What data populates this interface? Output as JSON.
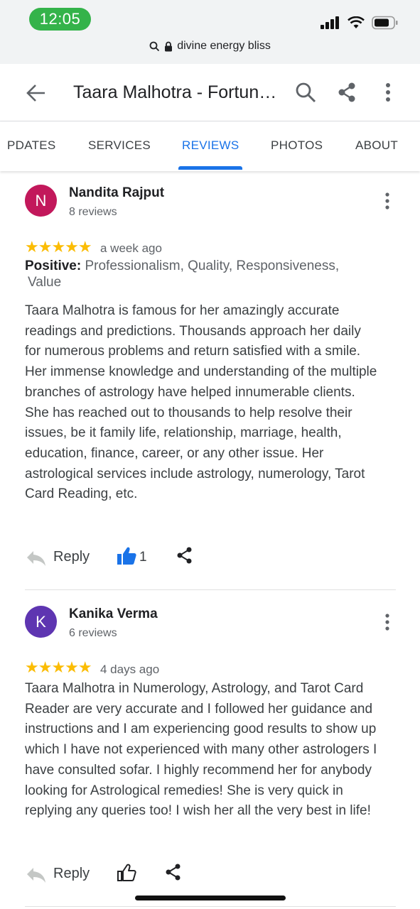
{
  "status": {
    "time": "12:05"
  },
  "url": {
    "text": "divine energy bliss"
  },
  "appbar": {
    "title": "Taara Malhotra - Fortune Teller"
  },
  "tabs": [
    {
      "label": "PDATES"
    },
    {
      "label": "SERVICES"
    },
    {
      "label": "REVIEWS",
      "active": true
    },
    {
      "label": "PHOTOS"
    },
    {
      "label": "ABOUT"
    }
  ],
  "reviews": [
    {
      "initial": "N",
      "avatar_color": "#c2185b",
      "name": "Nandita Rajput",
      "count": "8 reviews",
      "stars": "★★★★★",
      "rating": 5,
      "date": "a week ago",
      "positive_label": "Positive:",
      "positive_values": "Professionalism, Quality, Responsiveness,",
      "positive_values_2": "Value",
      "text": "Taara Malhotra is famous for her amazingly accurate readings and predictions. Thousands approach her daily for numerous problems and return satisfied with a smile. Her immense knowledge and understanding of the multiple branches of astrology have helped innumerable clients. She has reached out to thousands to help resolve their issues, be it family life, relationship, marriage, health, education, finance, career, or any other issue. Her astrological services include astrology, numerology, Tarot Card Reading, etc.",
      "reply_label": "Reply",
      "likes": "1"
    },
    {
      "initial": "K",
      "avatar_color": "#5e35b1",
      "name": "Kanika Verma",
      "count": "6 reviews",
      "stars": "★★★★★",
      "rating": 5,
      "date": "4 days ago",
      "text": "Taara Malhotra in Numerology, Astrology, and Tarot Card Reader are very accurate and I followed her guidance and instructions and I am experiencing good results to show up which I have not experienced with many other astrologers I have consulted sofar. I highly recommend her for anybody looking for Astrological remedies! She is very quick in replying any queries too! I wish her all the very best in life!",
      "reply_label": "Reply"
    }
  ],
  "colors": {
    "accent": "#1a73e8",
    "star": "#fbbc04",
    "time_pill": "#34b34a"
  }
}
